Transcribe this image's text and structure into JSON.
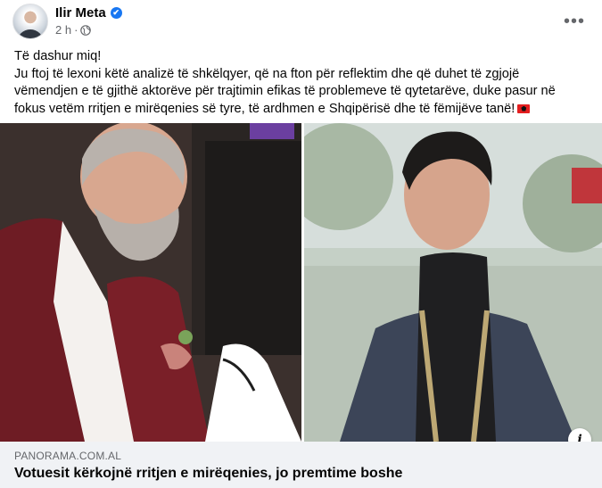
{
  "post": {
    "author": "Ilir Meta",
    "time": "2 h",
    "separator": "·",
    "verified_icon": "✔",
    "more_icon": "•••",
    "text_lines": [
      "Të dashur miq!",
      "Ju ftoj të lexoni këtë analizë të shkëlqyer, që na fton për reflektim dhe që duhet të zgjojë vëmendjen e të gjithë aktorëve për trajtimin efikas të problemeve të qytetarëve, duke pasur në fokus vetëm rritjen e mirëqenies së tyre, të ardhmen e Shqipërisë dhe të fëmijëve tanë!"
    ]
  },
  "link": {
    "domain": "PANORAMA.COM.AL",
    "headline": "Votuesit kërkojnë rritjen e mirëqenies, jo premtime boshe",
    "info_icon": "i"
  },
  "colors": {
    "accent": "#1877f2",
    "caption_bg": "#f0f2f5",
    "secondary_text": "#65676b"
  }
}
